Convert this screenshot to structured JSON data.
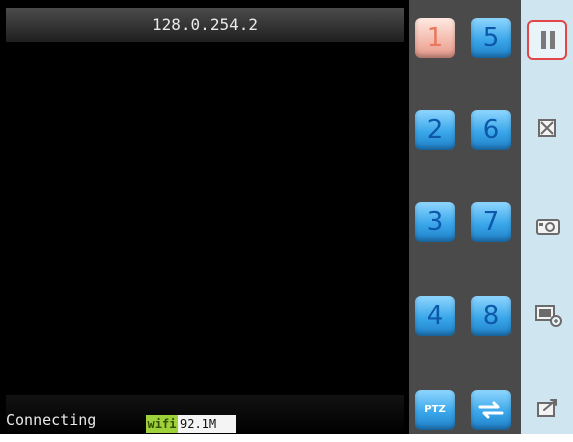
{
  "window": {
    "title": "128.0.254.2"
  },
  "status": {
    "text": "Connecting",
    "wifi_label": "wifi",
    "rate": "92.1M"
  },
  "channels": {
    "buttons": [
      "1",
      "2",
      "3",
      "4",
      "5",
      "6",
      "7",
      "8"
    ],
    "active": "1",
    "ptz_label": "PTZ"
  },
  "toolbar": {
    "icons": [
      "pause-icon",
      "close-view-icon",
      "camera-snapshot-icon",
      "record-icon",
      "exit-icon"
    ]
  },
  "colors": {
    "panel_bg": "#4a4a4a",
    "toolbar_bg": "#cfe6f0",
    "channel_blue": "#3aa7ea",
    "channel_active": "#f3b8aa",
    "active_outline": "#e24646"
  }
}
